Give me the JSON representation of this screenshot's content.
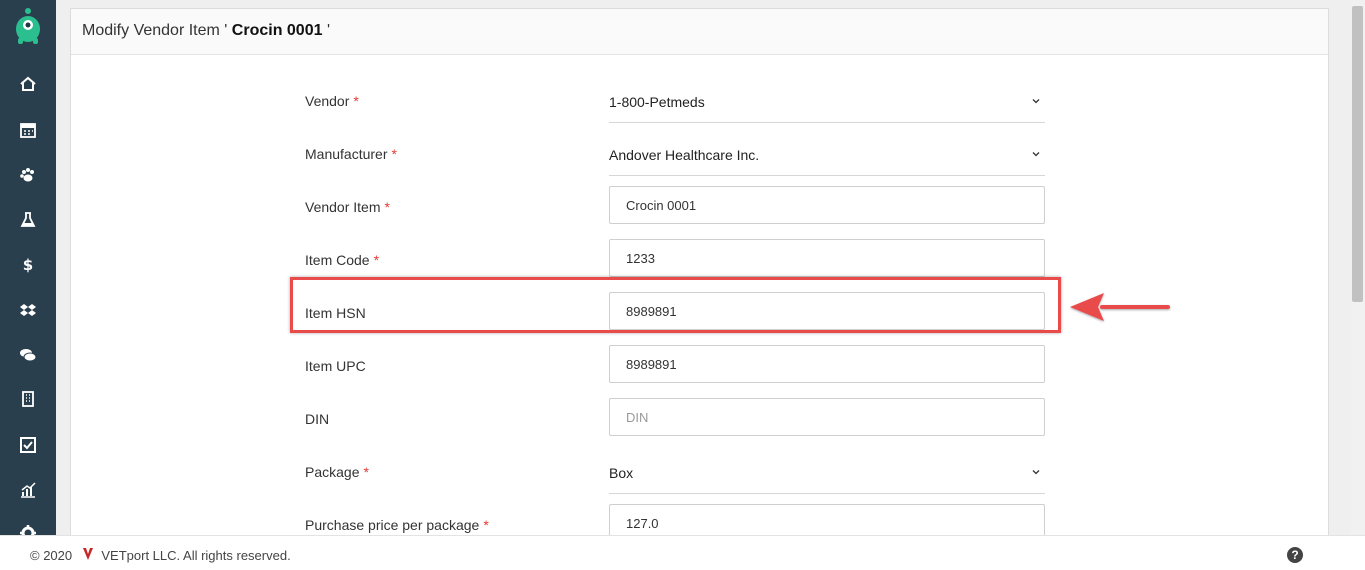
{
  "panel": {
    "title_prefix": "Modify Vendor Item '",
    "title_name": " Crocin 0001 ",
    "title_suffix": "'"
  },
  "form": {
    "required_mark": "*",
    "vendor": {
      "label": "Vendor",
      "value": "1-800-Petmeds"
    },
    "manufacturer": {
      "label": "Manufacturer",
      "value": "Andover Healthcare Inc."
    },
    "vendor_item": {
      "label": "Vendor Item",
      "value": "Crocin 0001"
    },
    "item_code": {
      "label": "Item Code",
      "value": "1233"
    },
    "item_hsn": {
      "label": "Item HSN",
      "value": "8989891"
    },
    "item_upc": {
      "label": "Item UPC",
      "value": "8989891"
    },
    "din": {
      "label": "DIN",
      "value": "",
      "placeholder": "DIN"
    },
    "package": {
      "label": "Package",
      "value": "Box"
    },
    "purchase_price": {
      "label": "Purchase price per package",
      "value": "127.0"
    }
  },
  "sidebar": {
    "icons": [
      "home-icon",
      "calendar-icon",
      "paw-icon",
      "flask-icon",
      "dollar-icon",
      "dropbox-icon",
      "comments-icon",
      "building-icon",
      "check-square-icon",
      "chart-icon",
      "gear-icon"
    ]
  },
  "footer": {
    "copyright_prefix": "© 2020",
    "copyright_suffix": "VETport LLC. All rights reserved.",
    "help_label": "?"
  },
  "colors": {
    "sidebar": "#2a3f4d",
    "highlight": "#e94b4b",
    "required": "#e53935",
    "logo": "#2bbf8f"
  }
}
